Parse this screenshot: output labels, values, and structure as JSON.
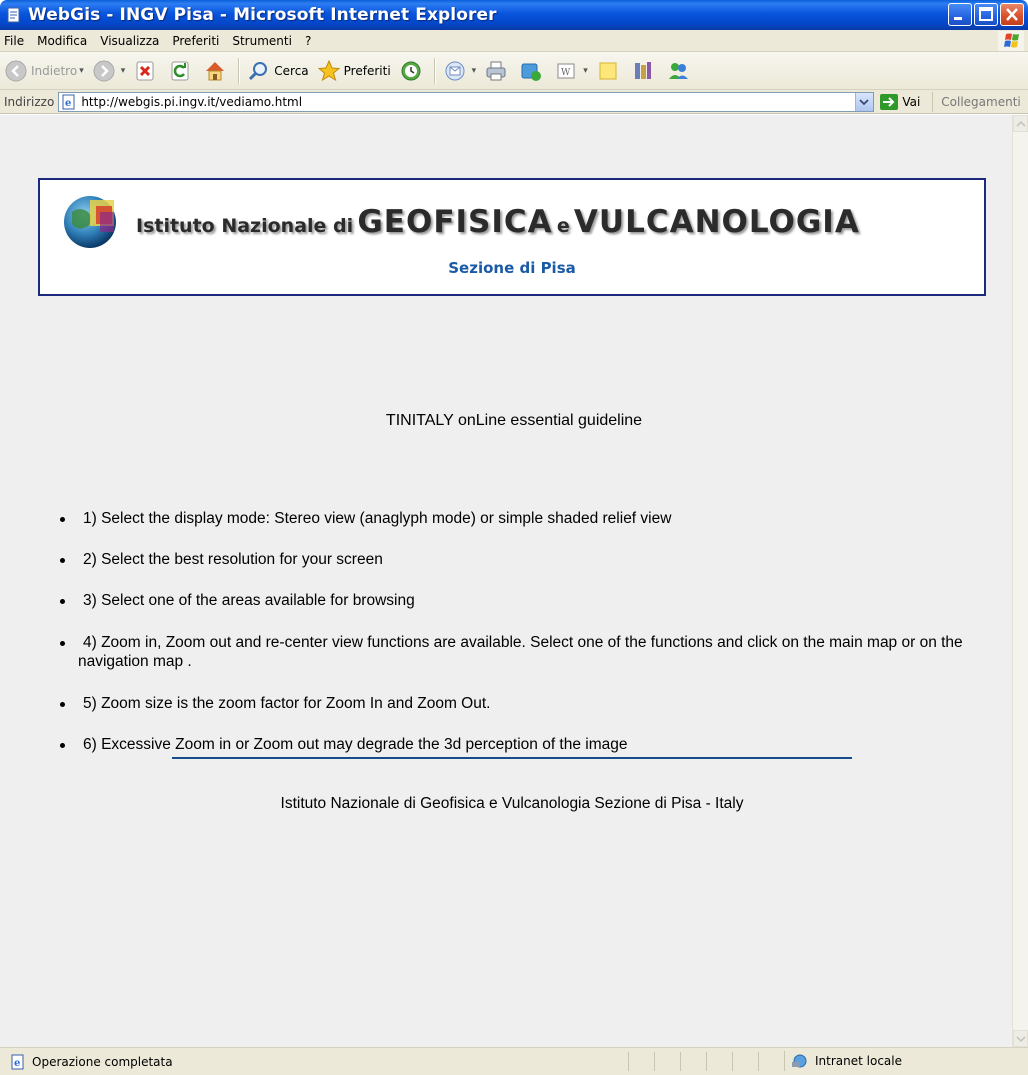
{
  "window": {
    "title": "WebGis - INGV Pisa - Microsoft Internet Explorer"
  },
  "menubar": {
    "items": [
      "File",
      "Modifica",
      "Visualizza",
      "Preferiti",
      "Strumenti",
      "?"
    ]
  },
  "toolbar": {
    "back_label": "Indietro",
    "search_label": "Cerca",
    "favorites_label": "Preferiti"
  },
  "addressbar": {
    "label": "Indirizzo",
    "url": "http://webgis.pi.ingv.it/vediamo.html",
    "go_label": "Vai",
    "links_label": "Collegamenti"
  },
  "page": {
    "banner": {
      "title_part1": "Istituto Nazionale di",
      "title_part2": "GEOFISICA",
      "title_part3": "e",
      "title_part4": "VULCANOLOGIA",
      "subtitle": "Sezione di Pisa"
    },
    "guideline_title": "TINITALY onLine essential guideline",
    "steps": [
      "1) Select the display mode: Stereo view (anaglyph mode) or simple shaded relief view",
      "2) Select the best resolution for your screen",
      "3) Select one of the areas available for browsing",
      "4) Zoom in, Zoom out and re-center view functions are available. Select one of the functions and click on the main map or on the navigation map .",
      "5) Zoom size is the zoom factor for Zoom In and Zoom Out.",
      "6) Excessive Zoom in or Zoom out may degrade the 3d perception of the image"
    ],
    "footer": "Istituto Nazionale di Geofisica e Vulcanologia Sezione di Pisa - Italy"
  },
  "statusbar": {
    "text": "Operazione completata",
    "zone": "Intranet locale"
  },
  "colors": {
    "banner_border": "#1b2a7e",
    "subtitle": "#1a5aa6",
    "footer_rule": "#154c8a",
    "page_bg": "#efefef"
  }
}
